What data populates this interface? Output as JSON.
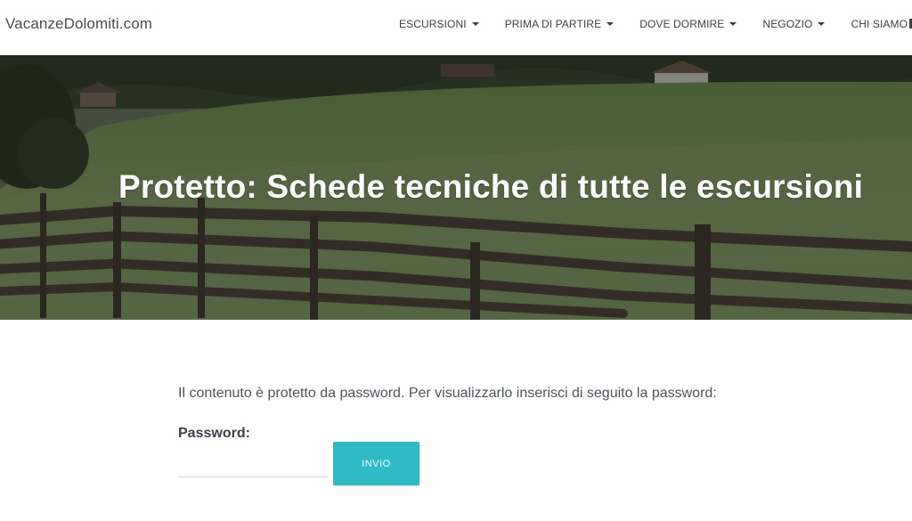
{
  "site": {
    "logo": "VacanzeDolomiti.com"
  },
  "nav": {
    "items": [
      {
        "label": "ESCURSIONI"
      },
      {
        "label": "PRIMA DI PARTIRE"
      },
      {
        "label": "DOVE DORMIRE"
      },
      {
        "label": "NEGOZIO"
      },
      {
        "label": "CHI SIAMO"
      }
    ]
  },
  "hero": {
    "title": "Protetto: Schede tecniche di tutte le escursioni"
  },
  "content": {
    "intro": "Il contenuto è protetto da password. Per visualizzarlo inserisci di seguito la password:",
    "password_label": "Password:",
    "password_value": "",
    "submit_label": "INVIO"
  },
  "colors": {
    "accent": "#2fbac6",
    "text": "#3a4148"
  },
  "icons": {
    "nav_caret": "caret-down-icon"
  }
}
